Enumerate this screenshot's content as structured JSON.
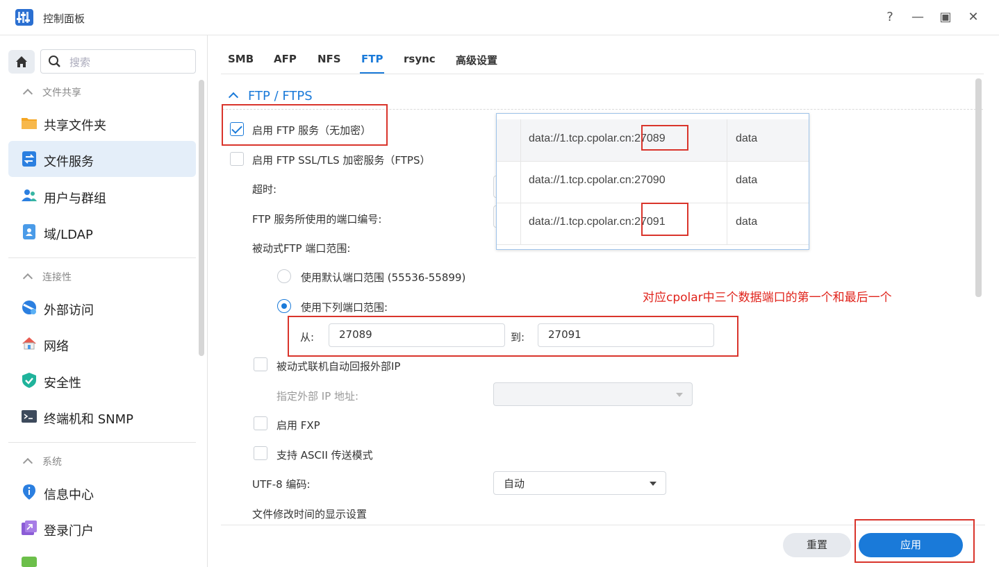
{
  "window": {
    "title": "控制面板",
    "help": "?",
    "minimize": "—",
    "maximize": "▣",
    "close": "✕"
  },
  "sidebar": {
    "search_placeholder": "搜索",
    "groups": [
      {
        "label": "文件共享",
        "items": [
          "共享文件夹",
          "文件服务",
          "用户与群组",
          "域/LDAP"
        ]
      },
      {
        "label": "连接性",
        "items": [
          "外部访问",
          "网络",
          "安全性",
          "终端机和 SNMP"
        ]
      },
      {
        "label": "系统",
        "items": [
          "信息中心",
          "登录门户"
        ]
      }
    ],
    "active_item": "文件服务"
  },
  "tabs": [
    "SMB",
    "AFP",
    "NFS",
    "FTP",
    "rsync",
    "高级设置"
  ],
  "active_tab": "FTP",
  "section": {
    "title": "FTP / FTPS",
    "enable_ftp": {
      "label": "启用 FTP 服务（无加密）",
      "checked": true
    },
    "enable_ftps": {
      "label": "启用 FTP SSL/TLS 加密服务（FTPS）",
      "checked": false
    },
    "timeout_label": "超时:",
    "port_label": "FTP 服务所使用的端口编号:",
    "passive_label": "被动式FTP 端口范围:",
    "radio_default": {
      "label": "使用默认端口范围 (55536-55899)",
      "selected": false
    },
    "radio_custom": {
      "label": "使用下列端口范围:",
      "selected": true
    },
    "from_label": "从:",
    "from_value": "27089",
    "to_label": "到:",
    "to_value": "27091",
    "passive_report": {
      "label": "被动式联机自动回报外部IP",
      "checked": false
    },
    "external_ip_label": "指定外部 IP 地址:",
    "fxp": {
      "label": "启用 FXP",
      "checked": false
    },
    "ascii": {
      "label": "支持 ASCII 传送模式",
      "checked": false
    },
    "utf8_label": "UTF-8 编码:",
    "utf8_value": "自动",
    "mtime_label": "文件修改时间的显示设置"
  },
  "overlay_table": {
    "rows": [
      {
        "addr_prefix": "data://1.tcp.cpolar.cn:",
        "port": "27089",
        "type": "data"
      },
      {
        "addr_prefix": "data://1.tcp.cpolar.cn:",
        "port": "27090",
        "type": "data"
      },
      {
        "addr_prefix": "data://1.tcp.cpolar.cn:",
        "port": "27091",
        "type": "data"
      }
    ]
  },
  "annotation": "对应cpolar中三个数据端口的第一个和最后一个",
  "footer": {
    "reset": "重置",
    "apply": "应用"
  },
  "colors": {
    "accent": "#1a7ad9",
    "annotation_red": "#d9342b"
  }
}
